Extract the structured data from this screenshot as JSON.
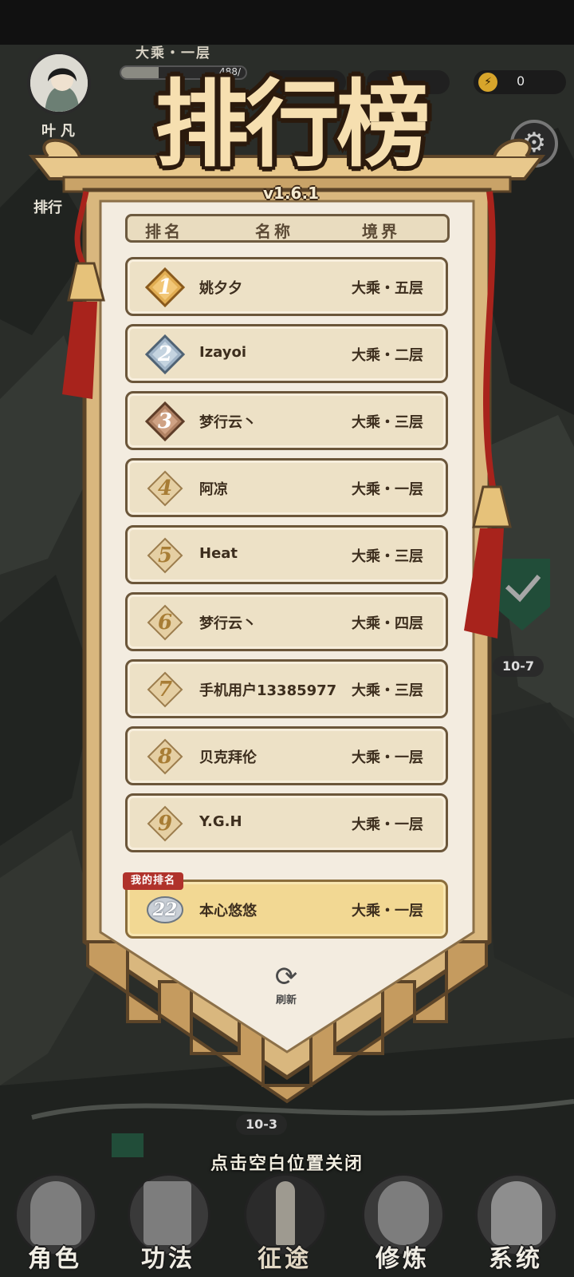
{
  "hud": {
    "player_name": "叶凡",
    "realm": "大乘・一层",
    "exp_text": "488/",
    "energy_value": "0"
  },
  "side": {
    "rank_button_label": "排行"
  },
  "title": "排行榜",
  "version": "v1.6.1",
  "table_header": {
    "rank": "排名",
    "name": "名称",
    "realm": "境界"
  },
  "rankings": [
    {
      "rank": "1",
      "name": "姚夕夕",
      "realm": "大乘・五层",
      "badge": "gold"
    },
    {
      "rank": "2",
      "name": "Izayoi",
      "realm": "大乘・二层",
      "badge": "silver"
    },
    {
      "rank": "3",
      "name": "梦行云丶",
      "realm": "大乘・三层",
      "badge": "bronze"
    },
    {
      "rank": "4",
      "name": "阿凉",
      "realm": "大乘・一层",
      "badge": "plain"
    },
    {
      "rank": "5",
      "name": "Heat",
      "realm": "大乘・三层",
      "badge": "plain"
    },
    {
      "rank": "6",
      "name": "梦行云丶",
      "realm": "大乘・四层",
      "badge": "plain"
    },
    {
      "rank": "7",
      "name": "手机用户13385977",
      "realm": "大乘・三层",
      "badge": "plain"
    },
    {
      "rank": "8",
      "name": "贝克拜伦",
      "realm": "大乘・一层",
      "badge": "plain"
    },
    {
      "rank": "9",
      "name": "Y.G.H",
      "realm": "大乘・一层",
      "badge": "plain"
    }
  ],
  "my_rank": {
    "tag": "我的排名",
    "rank": "22",
    "name": "本心悠悠",
    "realm": "大乘・一层"
  },
  "refresh_label": "刷新",
  "close_hint": "点击空白位置关闭",
  "stages": [
    "10-7",
    "10-3"
  ],
  "nav": [
    {
      "label": "角色",
      "icon": "character-icon"
    },
    {
      "label": "功法",
      "icon": "book-icon"
    },
    {
      "label": "征途",
      "icon": "sword-icon"
    },
    {
      "label": "修炼",
      "icon": "meditation-icon"
    },
    {
      "label": "系统",
      "icon": "system-icon"
    }
  ],
  "colors": {
    "banner": "#d9b77e",
    "banner_border": "#5c4428",
    "panel": "#f3ece0",
    "row": "#ede1c6",
    "my_row": "#f2d893",
    "tassel": "#a8231c",
    "tag": "#b0322b"
  }
}
